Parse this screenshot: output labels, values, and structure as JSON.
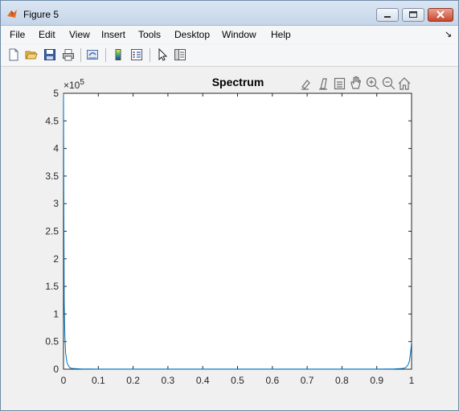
{
  "window": {
    "title": "Figure 5"
  },
  "menu": {
    "items": [
      "File",
      "Edit",
      "View",
      "Insert",
      "Tools",
      "Desktop",
      "Window",
      "Help"
    ]
  },
  "toolbar": {
    "icons": [
      "new-figure-icon",
      "open-file-icon",
      "save-icon",
      "print-icon",
      "link-plot-icon",
      "colorbar-icon",
      "legend-icon",
      "pointer-icon",
      "property-editor-icon"
    ]
  },
  "axes_toolbar": {
    "icons": [
      "brush-icon",
      "data-tips-icon",
      "export-icon",
      "pan-icon",
      "zoom-in-icon",
      "zoom-out-icon",
      "home-icon"
    ]
  },
  "chart_data": {
    "type": "line",
    "title": "Spectrum",
    "xlabel": "",
    "ylabel": "",
    "y_exponent_label": "×10",
    "y_exponent_power": "5",
    "xlim": [
      0,
      1
    ],
    "ylim": [
      0,
      5
    ],
    "xticks": [
      "0",
      "0.1",
      "0.2",
      "0.3",
      "0.4",
      "0.5",
      "0.6",
      "0.7",
      "0.8",
      "0.9",
      "1"
    ],
    "yticks": [
      "0",
      "0.5",
      "1",
      "1.5",
      "2",
      "2.5",
      "3",
      "3.5",
      "4",
      "4.5",
      "5"
    ],
    "series": [
      {
        "color": "#0072bd",
        "x": [
          0,
          0.001,
          0.002,
          0.004,
          0.006,
          0.01,
          0.015,
          0.02,
          0.03,
          0.05,
          0.1,
          0.5,
          0.9,
          0.95,
          0.97,
          0.98,
          0.985,
          0.99,
          0.994,
          0.998,
          1
        ],
        "y": [
          5,
          2.9,
          1.2,
          0.6,
          0.3,
          0.12,
          0.05,
          0.02,
          0.01,
          0.005,
          0.002,
          0.001,
          0.002,
          0.005,
          0.01,
          0.02,
          0.04,
          0.08,
          0.15,
          0.35,
          0.5
        ]
      }
    ],
    "grid": false
  }
}
